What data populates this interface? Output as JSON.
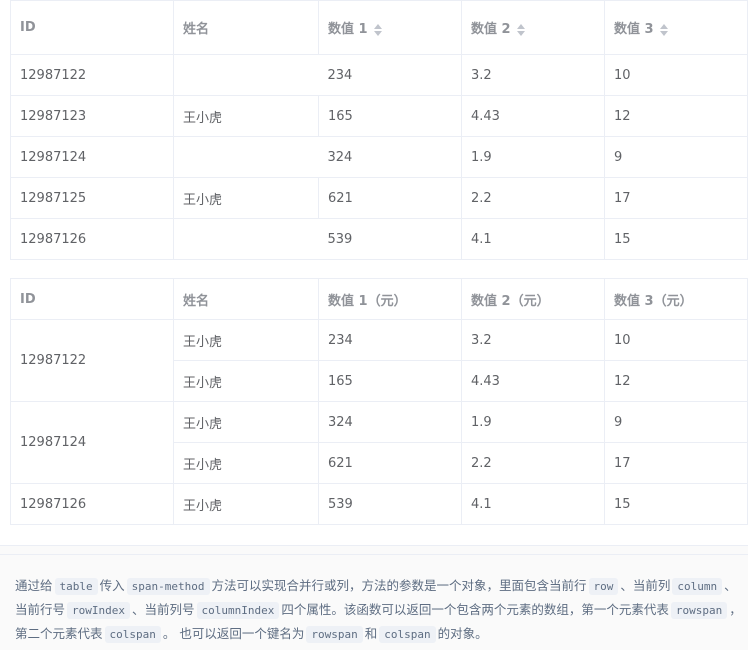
{
  "table1": {
    "headers": [
      "ID",
      "姓名",
      "数值 1",
      "数值 2",
      "数值 3"
    ],
    "rows": [
      [
        "12987122",
        "",
        "234",
        "3.2",
        "10"
      ],
      [
        "12987123",
        "王小虎",
        "165",
        "4.43",
        "12"
      ],
      [
        "12987124",
        "",
        "324",
        "1.9",
        "9"
      ],
      [
        "12987125",
        "王小虎",
        "621",
        "2.2",
        "17"
      ],
      [
        "12987126",
        "",
        "539",
        "4.1",
        "15"
      ]
    ]
  },
  "table2": {
    "headers": [
      "ID",
      "姓名",
      "数值 1（元）",
      "数值 2（元）",
      "数值 3（元）"
    ],
    "rows": [
      [
        "12987122",
        "王小虎",
        "234",
        "3.2",
        "10"
      ],
      [
        "",
        "王小虎",
        "165",
        "4.43",
        "12"
      ],
      [
        "12987124",
        "王小虎",
        "324",
        "1.9",
        "9"
      ],
      [
        "",
        "王小虎",
        "621",
        "2.2",
        "17"
      ],
      [
        "12987126",
        "王小虎",
        "539",
        "4.1",
        "15"
      ]
    ]
  },
  "description": {
    "t1": "通过给",
    "c1": "table",
    "t2": "传入",
    "c2": "span-method",
    "t3": "方法可以实现合并行或列，方法的参数是一个对象，里面包含当前行",
    "c3": "row",
    "t4": "、当前列",
    "c4": "column",
    "t5": "、当前行号",
    "c5": "rowIndex",
    "t6": "、当前列号",
    "c6": "columnIndex",
    "t7": "四个属性。该函数可以返回一个包含两个元素的数组，第一个元素代表",
    "c7": "rowspan",
    "t8": "，第二个元素代表",
    "c8": "colspan",
    "t9": "。 也可以返回一个键名为",
    "c9": "rowspan",
    "t10": "和",
    "c10": "colspan",
    "t11": "的对象。"
  },
  "colors": {
    "border": "#ebeef5",
    "header_text": "#909399",
    "cell_text": "#606266",
    "code_bg": "#eef1f6"
  }
}
